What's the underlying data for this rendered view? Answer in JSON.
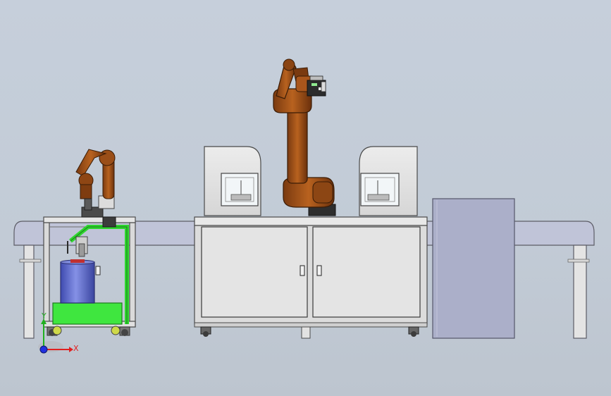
{
  "viewport": {
    "background_top": "#c6cfdb",
    "background_bottom": "#bdc5cf"
  },
  "colors": {
    "robot_orange": "#a9561c",
    "robot_dark": "#3a2a1e",
    "frame_gray": "#d8d8d8",
    "frame_edge": "#5a5a5a",
    "conveyor": "#bfc3d6",
    "green_frame": "#33e433",
    "barrel_blue": "#5f6fd0",
    "panel_blue_gray": "#a9adc7"
  },
  "triad": {
    "x_label": "X",
    "y_label": "Y",
    "x_color": "#e02020",
    "y_color": "#20b020",
    "z_color": "#2030e0"
  }
}
